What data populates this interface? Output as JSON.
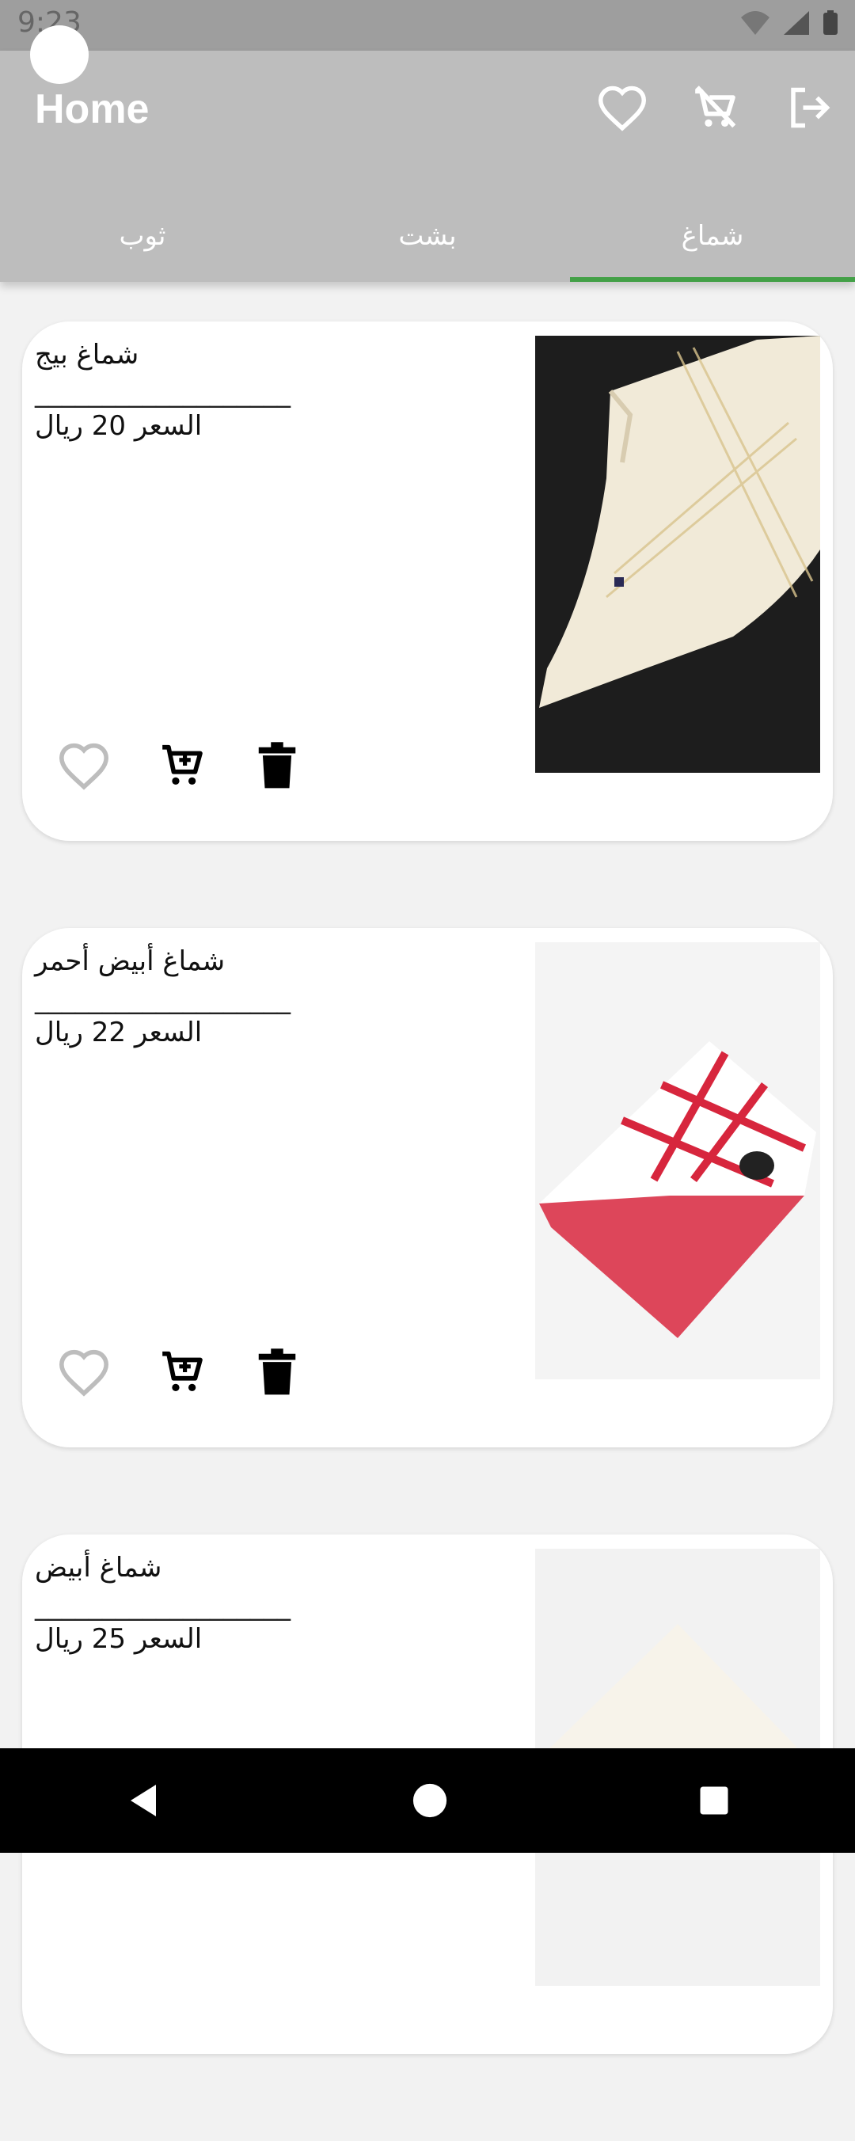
{
  "status_bar": {
    "time": "9:23"
  },
  "app_bar": {
    "title": "Home",
    "actions": [
      {
        "name": "favorites-icon",
        "label": "favorites"
      },
      {
        "name": "remove-from-cart-icon",
        "label": "cart off"
      },
      {
        "name": "logout-icon",
        "label": "logout"
      }
    ]
  },
  "tabs": [
    {
      "label": "ثوب",
      "selected": false
    },
    {
      "label": "بشت",
      "selected": false
    },
    {
      "label": "شماغ",
      "selected": true
    }
  ],
  "accent_color": "#43a047",
  "products": [
    {
      "name": "شماغ بيج",
      "separator": "___________________",
      "price": "السعر 20 ريال",
      "image": "beige-shemagh"
    },
    {
      "name": "شماغ أبيض أحمر",
      "separator": "___________________",
      "price": "السعر 22 ريال",
      "image": "red-white-shemagh"
    },
    {
      "name": "شماغ أبيض",
      "separator": "___________________",
      "price": "السعر 25 ريال",
      "image": "white-shemagh"
    }
  ]
}
